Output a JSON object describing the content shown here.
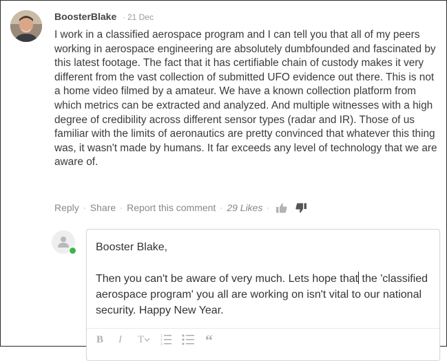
{
  "comment": {
    "author": "BoosterBlake",
    "separator": "·",
    "date": "21 Dec",
    "body": "I work in a classified aerospace program and I can tell you that all of my peers working in aerospace engineering are absolutely dumbfounded and fascinated by this latest footage.  The fact that it has certifiable chain of custody makes it very different from the vast collection of submitted UFO evidence out there.  This is not a home video filmed by a amateur.  We have a known collection platform from which metrics can be extracted and analyzed.  And multiple witnesses with a high degree of credibility across different sensor types (radar and IR).  Those of us familiar with the limits of aeronautics are pretty convinced that whatever this thing was, it wasn't made by humans.  It far exceeds any level of technology that we are aware of.",
    "actions": {
      "reply": "Reply",
      "share": "Share",
      "report": "Report this comment",
      "likes": "29 Likes",
      "dot": "·"
    }
  },
  "reply_editor": {
    "line1": "Booster Blake,",
    "line2_before_caret": "Then you can't be aware of very much. Lets hope that",
    "line2_after_caret": " the 'classified aerospace program' you all are working on isn't vital to our national security. Happy New Year.",
    "toolbar": {
      "bold": "B",
      "italic": "I",
      "text_size": "T",
      "quote": "“"
    }
  },
  "colors": {
    "online": "#3cb54a",
    "meta": "#888888",
    "text": "#3a3a3a"
  }
}
